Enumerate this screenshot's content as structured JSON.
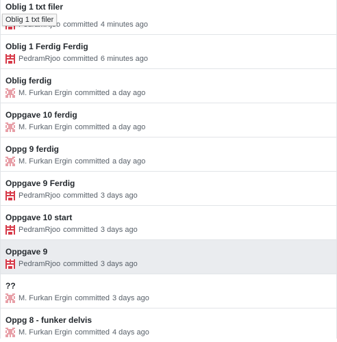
{
  "tooltip": {
    "text": "Oblig 1 txt filer"
  },
  "commits": [
    {
      "title": "Oblig 1 txt filer",
      "author": "PedramRjoo",
      "verb": "committed",
      "time": "4 minutes ago",
      "avatar": "pedram-avatar-icon"
    },
    {
      "title": "Oblig 1 Ferdig Ferdig",
      "author": "PedramRjoo",
      "verb": "committed",
      "time": "6 minutes ago",
      "avatar": "pedram-avatar-icon"
    },
    {
      "title": "Oblig ferdig",
      "author": "M. Furkan Ergin",
      "verb": "committed",
      "time": "a day ago",
      "avatar": "furkan-avatar-icon"
    },
    {
      "title": "Oppgave 10 ferdig",
      "author": "M. Furkan Ergin",
      "verb": "committed",
      "time": "a day ago",
      "avatar": "furkan-avatar-icon"
    },
    {
      "title": "Oppg 9 ferdig",
      "author": "M. Furkan Ergin",
      "verb": "committed",
      "time": "a day ago",
      "avatar": "furkan-avatar-icon"
    },
    {
      "title": "Oppgave 9 Ferdig",
      "author": "PedramRjoo",
      "verb": "committed",
      "time": "3 days ago",
      "avatar": "pedram-avatar-icon"
    },
    {
      "title": "Oppgave 10 start",
      "author": "PedramRjoo",
      "verb": "committed",
      "time": "3 days ago",
      "avatar": "pedram-avatar-icon"
    },
    {
      "title": "Oppgave 9",
      "author": "PedramRjoo",
      "verb": "committed",
      "time": "3 days ago",
      "avatar": "pedram-avatar-icon",
      "highlighted": true
    },
    {
      "title": "??",
      "author": "M. Furkan Ergin",
      "verb": "committed",
      "time": "3 days ago",
      "avatar": "furkan-avatar-icon"
    },
    {
      "title": "Oppg 8 - funker delvis",
      "author": "M. Furkan Ergin",
      "verb": "committed",
      "time": "4 days ago",
      "avatar": "furkan-avatar-icon"
    }
  ],
  "colors": {
    "pedram_avatar": "#d73a49",
    "furkan_avatar": "#e8a0a8",
    "highlight_row": "#eaecef"
  }
}
